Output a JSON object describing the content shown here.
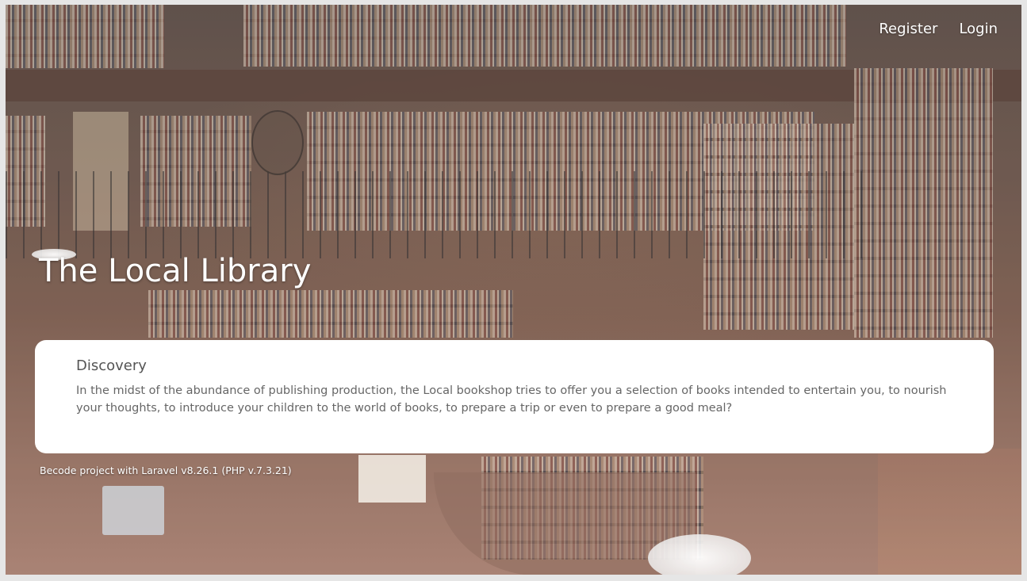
{
  "nav": {
    "register_label": "Register",
    "login_label": "Login"
  },
  "hero": {
    "title": "The Local Library"
  },
  "card": {
    "heading": "Discovery",
    "body": "In the midst of the abundance of publishing production, the Local bookshop tries to offer you a selection of books intended to entertain you, to nourish your thoughts, to introduce your children to the world of books, to prepare a trip or even to prepare a good meal?"
  },
  "footer": {
    "note": "Becode project with Laravel v8.26.1 (PHP v.7.3.21)"
  },
  "colors": {
    "card_background": "#ffffff",
    "text_light": "#ffffff",
    "card_heading": "#555555",
    "card_text": "#666666"
  }
}
